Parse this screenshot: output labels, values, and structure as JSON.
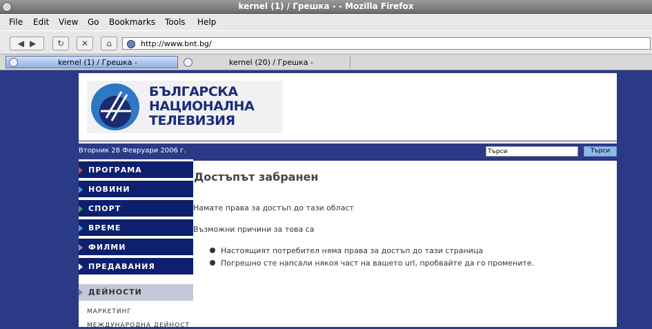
{
  "window": {
    "title": "kernel (1) / Грешка - - Mozilla Firefox"
  },
  "menu": [
    "File",
    "Edit",
    "View",
    "Go",
    "Bookmarks",
    "Tools",
    "Help"
  ],
  "toolbar": {
    "back_icon": "◀",
    "forward_icon": "▶",
    "reload_icon": "↻",
    "stop_icon": "✕",
    "home_icon": "⌂",
    "url": "http://www.bnt.bg/"
  },
  "tabs": [
    {
      "label": "kernel (1) / Грешка -",
      "active": true
    },
    {
      "label": "kernel (20) / Грешка -",
      "active": false
    }
  ],
  "site": {
    "logo": [
      "БЪЛГАРСКА",
      "НАЦИОНАЛНА",
      "ТЕЛЕВИЗИЯ"
    ],
    "date": "Вторник 28 Февруари 2006 г.",
    "search_value": "Търси",
    "search_button": "Търси"
  },
  "sidebar": {
    "items": [
      {
        "label": "ПРОГРАМА",
        "color": "#d9453c"
      },
      {
        "label": "НОВИНИ",
        "color": "#3aa0e8"
      },
      {
        "label": "СПОРТ",
        "color": "#37a84a"
      },
      {
        "label": "ВРЕМЕ",
        "color": "#3aa0e8"
      },
      {
        "label": "ФИЛМИ",
        "color": "#8a8fb0"
      },
      {
        "label": "ПРЕДАВАНИЯ",
        "color": "#ffffff"
      }
    ],
    "section": "ДЕЙНОСТИ",
    "links": [
      "МАРКЕТИНГ",
      "МЕЖДУНАРОДНА ДЕЙНОСТ"
    ]
  },
  "content": {
    "title": "Достъпът забранен",
    "p1": "Намате права за достъп до тази област",
    "p2": "Възможни причини за това са",
    "reasons": [
      "Настоящият потребител няма права за достъп до тази страница",
      "Погрешно сте напсали някоя част на вашето url, пробвайте да го промените."
    ]
  }
}
